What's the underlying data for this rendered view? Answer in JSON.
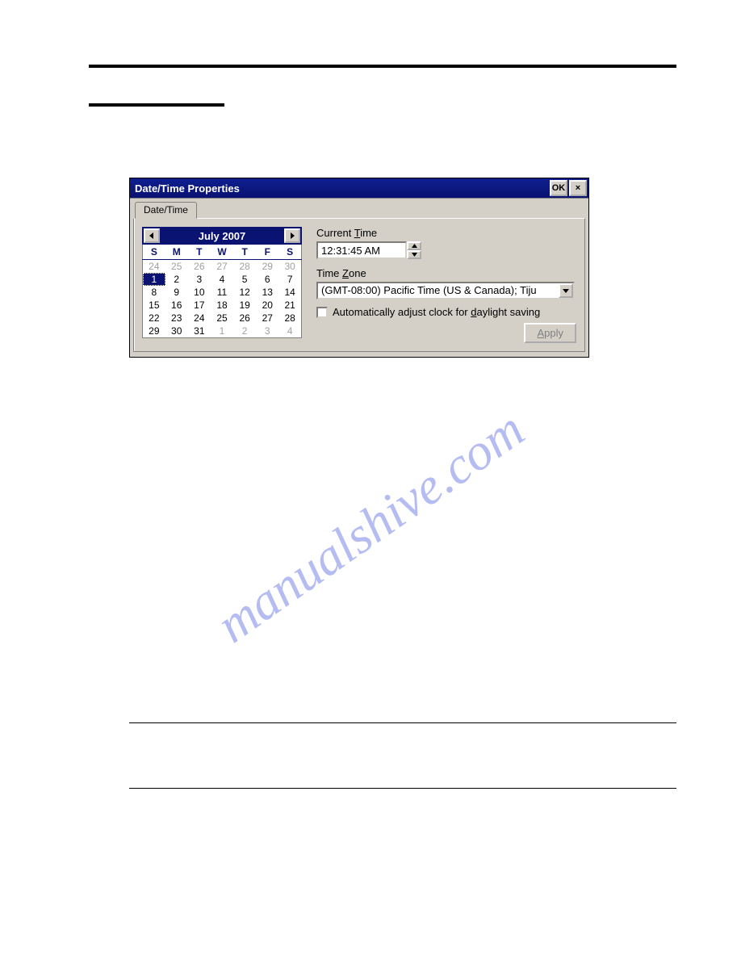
{
  "dialog": {
    "title": "Date/Time Properties",
    "ok_label": "OK",
    "close_label": "×",
    "tab_label": "Date/Time",
    "apply_label": "Apply"
  },
  "calendar": {
    "month_label": "July 2007",
    "day_headers": [
      "S",
      "M",
      "T",
      "W",
      "T",
      "F",
      "S"
    ],
    "weeks": [
      [
        {
          "n": 24,
          "dim": true
        },
        {
          "n": 25,
          "dim": true
        },
        {
          "n": 26,
          "dim": true
        },
        {
          "n": 27,
          "dim": true
        },
        {
          "n": 28,
          "dim": true
        },
        {
          "n": 29,
          "dim": true
        },
        {
          "n": 30,
          "dim": true
        }
      ],
      [
        {
          "n": 1,
          "sel": true
        },
        {
          "n": 2
        },
        {
          "n": 3
        },
        {
          "n": 4
        },
        {
          "n": 5
        },
        {
          "n": 6
        },
        {
          "n": 7
        }
      ],
      [
        {
          "n": 8
        },
        {
          "n": 9
        },
        {
          "n": 10
        },
        {
          "n": 11
        },
        {
          "n": 12
        },
        {
          "n": 13
        },
        {
          "n": 14
        }
      ],
      [
        {
          "n": 15
        },
        {
          "n": 16
        },
        {
          "n": 17
        },
        {
          "n": 18
        },
        {
          "n": 19
        },
        {
          "n": 20
        },
        {
          "n": 21
        }
      ],
      [
        {
          "n": 22
        },
        {
          "n": 23
        },
        {
          "n": 24
        },
        {
          "n": 25
        },
        {
          "n": 26
        },
        {
          "n": 27
        },
        {
          "n": 28
        }
      ],
      [
        {
          "n": 29
        },
        {
          "n": 30
        },
        {
          "n": 31
        },
        {
          "n": 1,
          "dim": true
        },
        {
          "n": 2,
          "dim": true
        },
        {
          "n": 3,
          "dim": true
        },
        {
          "n": 4,
          "dim": true
        }
      ]
    ]
  },
  "time": {
    "label_pre": "Current ",
    "label_u": "T",
    "label_post": "ime",
    "value": "12:31:45 AM"
  },
  "timezone": {
    "label_pre": "Time ",
    "label_u": "Z",
    "label_post": "one",
    "value": "(GMT-08:00) Pacific Time (US & Canada); Tiju"
  },
  "dst": {
    "label_pre": "Automatically adjust clock for ",
    "label_u": "d",
    "label_post": "aylight saving",
    "checked": false
  },
  "watermark": "manualshive.com"
}
